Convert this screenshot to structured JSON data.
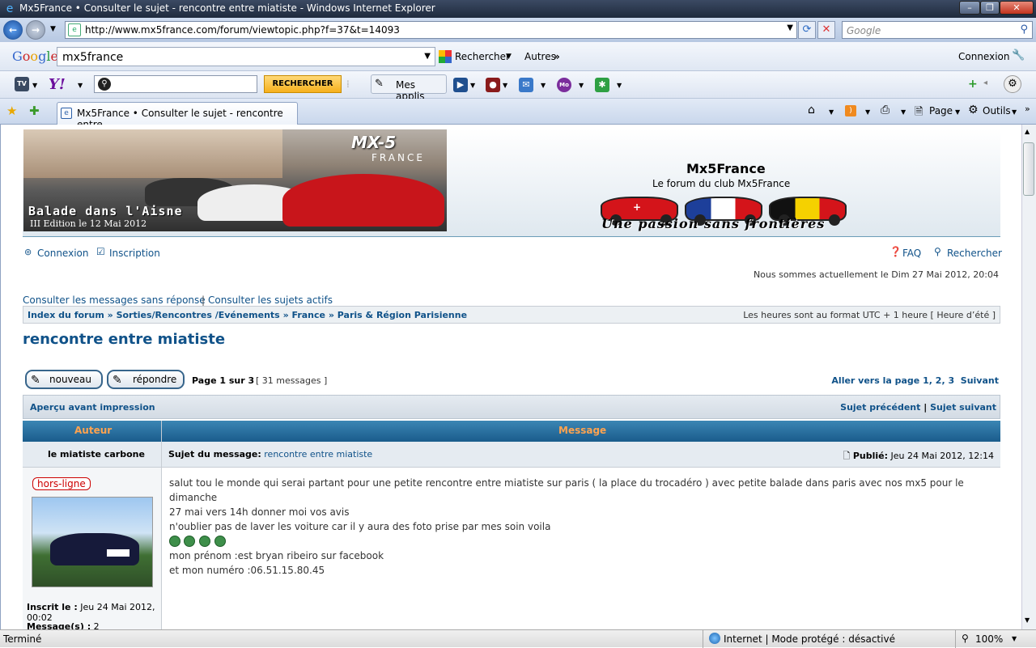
{
  "window": {
    "title": "Mx5France • Consulter le sujet - rencontre entre miatiste - Windows Internet Explorer"
  },
  "browser": {
    "url": "http://www.mx5france.com/forum/viewtopic.php?f=37&t=14093",
    "search_placeholder": "Google",
    "tab_title": "Mx5France • Consulter le sujet - rencontre entre ...",
    "menu_page": "Page",
    "menu_tools": "Outils"
  },
  "google_toolbar": {
    "logo": "Google",
    "query": "mx5france",
    "search_btn": "Rechercher",
    "more": "Autres",
    "signin": "Connexion"
  },
  "yahoo_toolbar": {
    "search_btn": "RECHERCHER",
    "apps": "Mes applis"
  },
  "forum": {
    "banner_line1": "Balade dans l'Aisne",
    "banner_line2": "III Edition le 12 Mai 2012",
    "banner_logo": "MX-5",
    "banner_logo_sub": "FRANCE",
    "site_name": "Mx5France",
    "site_desc": "Le forum du club Mx5France",
    "slogan": "Une passion sans frontières",
    "login": "Connexion",
    "register": "Inscription",
    "faq": "FAQ",
    "search": "Rechercher",
    "datetime": "Nous sommes actuellement le Dim 27 Mai 2012, 20:04",
    "unanswered": "Consulter les messages sans réponse",
    "active": "Consulter les sujets actifs",
    "breadcrumb": [
      "Index du forum",
      "Sorties/Rencontres /Evénements",
      "France",
      "Paris & Région Parisienne"
    ],
    "timezone": "Les heures sont au format UTC + 1 heure [ Heure d’été ]",
    "topic_title": "rencontre entre miatiste",
    "btn_new": "nouveau",
    "btn_reply": "répondre",
    "page_info": "Page 1 sur 3",
    "msg_count": "[ 31 messages ]",
    "goto_page": "Aller vers la page",
    "pages": [
      "1",
      "2",
      "3"
    ],
    "next": "Suivant",
    "print_preview": "Aperçu avant impression",
    "prev_topic": "Sujet précédent",
    "next_topic": "Sujet suivant",
    "col_author": "Auteur",
    "col_message": "Message",
    "post": {
      "author": "le miatiste carbone",
      "subject_label": "Sujet du message:",
      "subject": "rencontre entre miatiste",
      "published_label": "Publié:",
      "published": "Jeu 24 Mai 2012, 12:14",
      "status": "hors-ligne",
      "line1": "salut tou le monde qui serai partant pour une petite rencontre entre miatiste sur paris ( la place du trocadéro ) avec petite balade dans paris avec nos mx5 pour le dimanche",
      "line2": "27 mai vers 14h donner moi vos avis",
      "line3": "n'oublier pas de laver les voiture car il y aura des foto prise par mes soin voila",
      "line4": "mon prénom :est bryan ribeiro sur facebook",
      "line5": "et mon numéro :06.51.15.80.45",
      "joined_label": "Inscrit le :",
      "joined": "Jeu 24 Mai 2012,",
      "joined_time": "00:02",
      "messages_label": "Message(s) :",
      "messages": "2"
    }
  },
  "statusbar": {
    "left": "Terminé",
    "zone": "Internet | Mode protégé : désactivé",
    "zoom": "100%"
  }
}
